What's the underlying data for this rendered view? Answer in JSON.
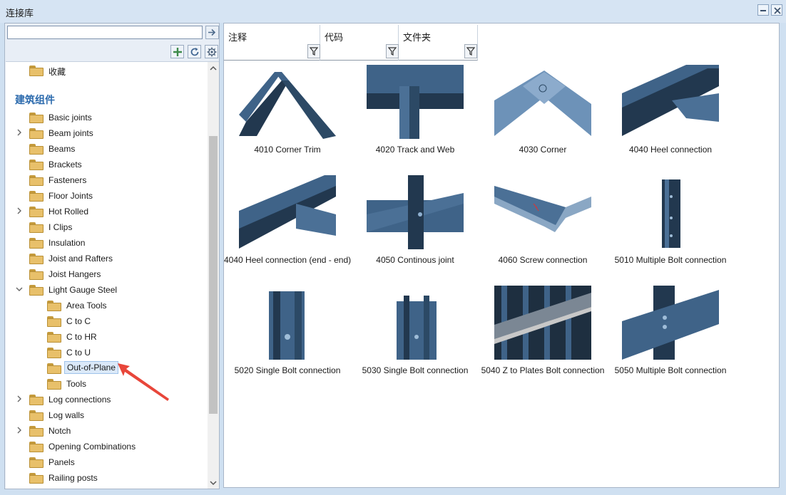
{
  "window": {
    "title": "连接库"
  },
  "search": {
    "value": "",
    "placeholder": ""
  },
  "tree": {
    "top_item": "收藏",
    "section_title": "建筑组件",
    "items": [
      {
        "label": "Basic joints",
        "expandable": false
      },
      {
        "label": "Beam joints",
        "expandable": true
      },
      {
        "label": "Beams",
        "expandable": false
      },
      {
        "label": "Brackets",
        "expandable": false
      },
      {
        "label": "Fasteners",
        "expandable": false
      },
      {
        "label": "Floor Joints",
        "expandable": false
      },
      {
        "label": "Hot Rolled",
        "expandable": true
      },
      {
        "label": "I Clips",
        "expandable": false
      },
      {
        "label": "Insulation",
        "expandable": false
      },
      {
        "label": "Joist and Rafters",
        "expandable": false
      },
      {
        "label": "Joist Hangers",
        "expandable": false
      },
      {
        "label": "Light Gauge Steel",
        "expandable": true,
        "expanded": true
      },
      {
        "label": "Area Tools",
        "child": true
      },
      {
        "label": "C to C",
        "child": true
      },
      {
        "label": "C to HR",
        "child": true
      },
      {
        "label": "C to U",
        "child": true
      },
      {
        "label": "Out-of-Plane",
        "child": true,
        "selected": true
      },
      {
        "label": "Tools",
        "child": true
      },
      {
        "label": "Log connections",
        "expandable": true
      },
      {
        "label": "Log walls",
        "expandable": false
      },
      {
        "label": "Notch",
        "expandable": true
      },
      {
        "label": "Opening Combinations",
        "expandable": false
      },
      {
        "label": "Panels",
        "expandable": false
      },
      {
        "label": "Railing posts",
        "expandable": false
      }
    ]
  },
  "columns": [
    "注释",
    "代码",
    "文件夹"
  ],
  "components": [
    "4010 Corner Trim",
    "4020 Track and Web",
    "4030 Corner",
    "4040 Heel connection",
    "4040 Heel connection (end - end)",
    "4050 Continous joint",
    "4060 Screw connection",
    "5010 Multiple Bolt connection",
    "5020 Single Bolt connection",
    "5030 Single Bolt connection",
    "5040 Z to Plates Bolt connection",
    "5050 Multiple Bolt connection"
  ],
  "colors": {
    "steel": "#3f6388",
    "steel_dark": "#22384f",
    "accent_arrow": "#e8463a",
    "section_title": "#2b6aad"
  }
}
